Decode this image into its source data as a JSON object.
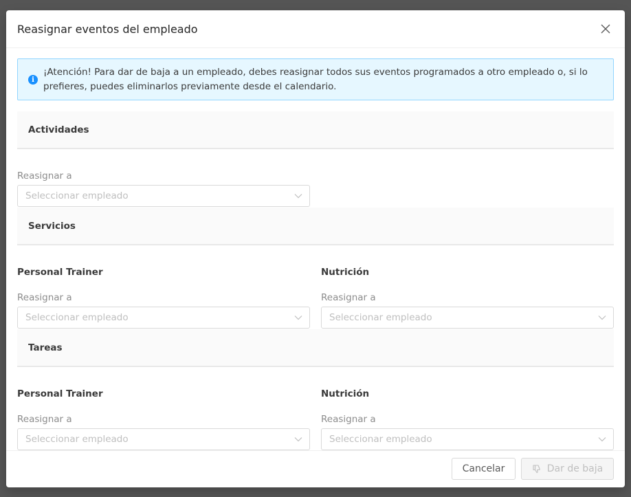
{
  "modal": {
    "title": "Reasignar eventos del empleado"
  },
  "alert": {
    "text": "¡Atención! Para dar de baja a un empleado, debes reasignar todos sus eventos programados a otro empleado o, si lo prefieres, puedes eliminarlos previamente desde el calendario."
  },
  "sections": {
    "activities": {
      "title": "Actividades",
      "reassign_label": "Reasignar a",
      "placeholder": "Seleccionar empleado"
    },
    "services": {
      "title": "Servicios",
      "left": {
        "name": "Personal Trainer",
        "reassign_label": "Reasignar a",
        "placeholder": "Seleccionar empleado"
      },
      "right": {
        "name": "Nutrición",
        "reassign_label": "Reasignar a",
        "placeholder": "Seleccionar empleado"
      }
    },
    "tasks": {
      "title": "Tareas",
      "left": {
        "name": "Personal Trainer",
        "reassign_label": "Reasignar a",
        "placeholder": "Seleccionar empleado"
      },
      "right": {
        "name": "Nutrición",
        "reassign_label": "Reasignar a",
        "placeholder": "Seleccionar empleado"
      }
    }
  },
  "footer": {
    "cancel_label": "Cancelar",
    "delete_label": "Dar de baja"
  },
  "colors": {
    "info_blue": "#1890ff",
    "alert_bg": "#e6f7ff",
    "alert_border": "#91d5ff"
  }
}
